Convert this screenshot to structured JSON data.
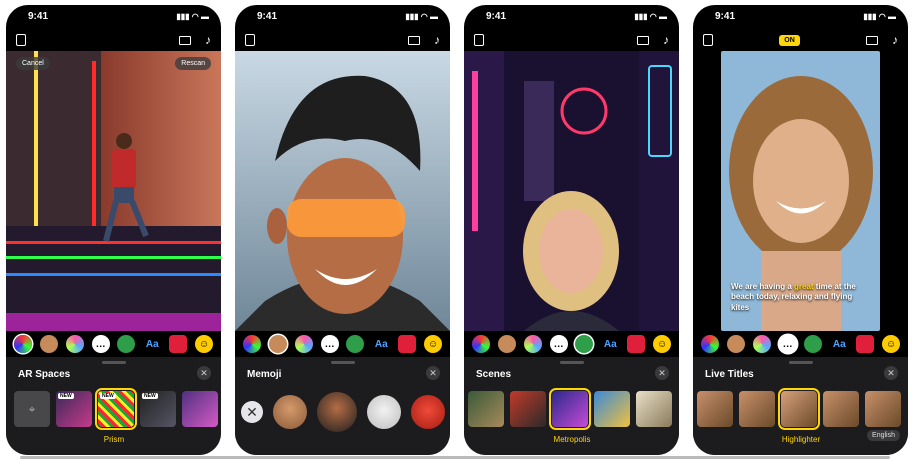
{
  "status": {
    "time": "9:41",
    "indicators": "▮▮▮ ◠ ▬"
  },
  "phones": [
    {
      "topbar": {
        "cancel": "Cancel",
        "rescan": "Rescan"
      },
      "panel": {
        "title": "AR Spaces",
        "close": "✕",
        "new_badge": "NEW",
        "selected_label": "Prism"
      }
    },
    {
      "panel": {
        "title": "Memoji",
        "close": "✕",
        "clear": "✕"
      }
    },
    {
      "panel": {
        "title": "Scenes",
        "close": "✕",
        "selected_label": "Metropolis"
      }
    },
    {
      "topbar": {
        "on_badge": "ON"
      },
      "caption": {
        "pre": "We are having a ",
        "highlight": "great",
        "post": " time at the beach today, relaxing and flying kites"
      },
      "panel": {
        "title": "Live Titles",
        "close": "✕",
        "selected_label": "Highlighter",
        "language": "English"
      }
    }
  ],
  "effects": {
    "text_label": "Aa",
    "sticker": "☺"
  },
  "colors": {
    "accent": "#ffd60a",
    "panel_bg": "#1c1c1e"
  }
}
